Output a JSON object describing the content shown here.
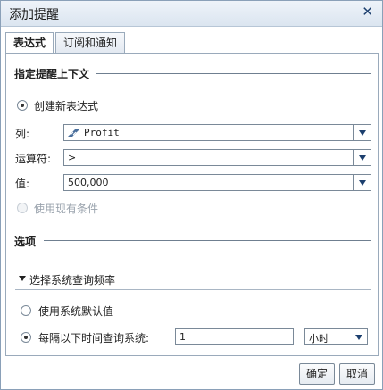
{
  "window": {
    "title": "添加提醒"
  },
  "tabs": [
    {
      "label": "表达式",
      "active": true
    },
    {
      "label": "订阅和通知",
      "active": false
    }
  ],
  "context": {
    "section_title": "指定提醒上下文",
    "create_new_label": "创建新表达式",
    "column_label": "列:",
    "column_value": "Profit",
    "column_icon": "measure-icon",
    "operator_label": "运算符:",
    "operator_value": ">",
    "value_label": "值:",
    "value_value": "500,000",
    "use_existing_label": "使用现有条件"
  },
  "options": {
    "section_title": "选项",
    "frequency_toggle_label": "选择系统查询频率",
    "use_default_label": "使用系统默认值",
    "interval_label": "每隔以下时间查询系统:",
    "interval_value": "1",
    "interval_unit": "小时"
  },
  "footer": {
    "ok_label": "确定",
    "cancel_label": "取消"
  },
  "colors": {
    "title_bg": "#dbe5f0",
    "accent": "#1c3f6e"
  }
}
